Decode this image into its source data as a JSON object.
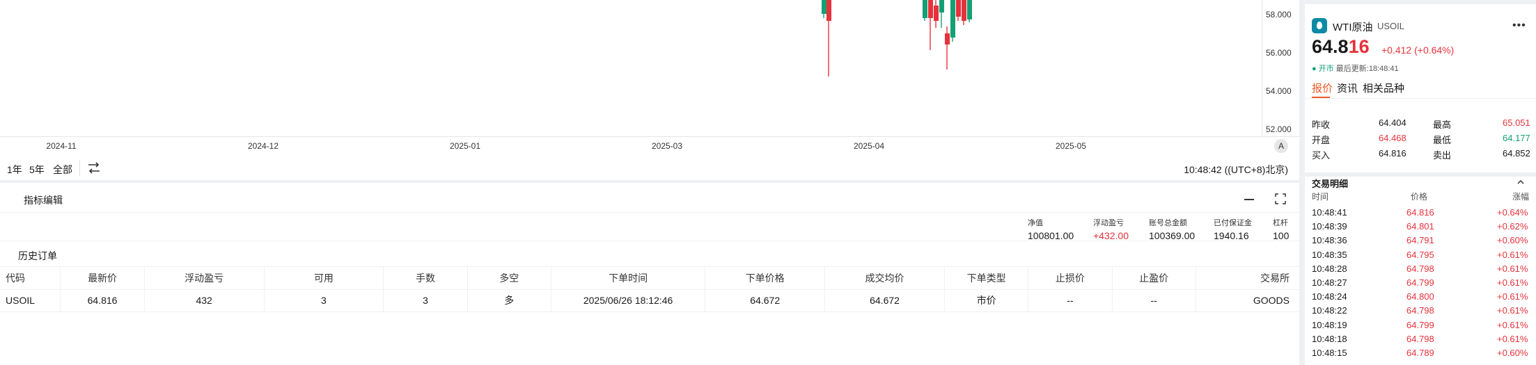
{
  "chart": {
    "price_ticks": [
      "58.000",
      "56.000",
      "54.000",
      "52.000"
    ],
    "x_ticks": [
      "2024-11",
      "2024-12",
      "2025-01",
      "2025-03",
      "2025-04",
      "2025-05"
    ],
    "auto_scale": "A",
    "colors": {
      "up": "#e5323b",
      "down": "#13a075"
    }
  },
  "range_bar": {
    "ranges": [
      "1年",
      "5年",
      "全部"
    ],
    "clock": "10:48:42 ((UTC+8)北京)"
  },
  "indicator": {
    "title": "指标编辑"
  },
  "account": [
    {
      "label": "净值",
      "value": "100801.00"
    },
    {
      "label": "浮动盈亏",
      "value": "+432.00"
    },
    {
      "label": "账号总金额",
      "value": "100369.00"
    },
    {
      "label": "已付保证金",
      "value": "1940.16"
    },
    {
      "label": "杠杆",
      "value": "100"
    }
  ],
  "history": {
    "title": "历史订单",
    "columns": [
      "代码",
      "最新价",
      "浮动盈亏",
      "可用",
      "手数",
      "多空",
      "下单时间",
      "下单价格",
      "成交均价",
      "下单类型",
      "止损价",
      "止盈价",
      "交易所"
    ],
    "rows": [
      [
        "USOIL",
        "64.816",
        "432",
        "3",
        "3",
        "多",
        "2025/06/26 18:12:46",
        "64.672",
        "64.672",
        "市价",
        "--",
        "--",
        "GOODS"
      ]
    ]
  },
  "side": {
    "name": "WTI原油",
    "code": "USOIL",
    "more": "•••",
    "price_head": "64.8",
    "price_tail": "16",
    "change": "+0.412 (+0.64%)",
    "status": "● 开市",
    "updated": "最后更新:18:48:41",
    "tabs": [
      "报价",
      "资讯",
      "相关品种"
    ],
    "quotes": [
      {
        "l1": "昨收",
        "v1": "64.404",
        "l2": "最高",
        "v2": "65.051"
      },
      {
        "l1": "开盘",
        "v1": "64.468",
        "l2": "最低",
        "v2": "64.177"
      },
      {
        "l1": "买入",
        "v1": "64.816",
        "l2": "卖出",
        "v2": "64.852"
      }
    ],
    "detail_title": "交易明细",
    "detail_columns": [
      "时间",
      "价格",
      "涨幅"
    ],
    "trades": [
      [
        "10:48:41",
        "64.816",
        "+0.64%"
      ],
      [
        "10:48:39",
        "64.801",
        "+0.62%"
      ],
      [
        "10:48:36",
        "64.791",
        "+0.60%"
      ],
      [
        "10:48:35",
        "64.795",
        "+0.61%"
      ],
      [
        "10:48:28",
        "64.798",
        "+0.61%"
      ],
      [
        "10:48:27",
        "64.799",
        "+0.61%"
      ],
      [
        "10:48:24",
        "64.800",
        "+0.61%"
      ],
      [
        "10:48:22",
        "64.798",
        "+0.61%"
      ],
      [
        "10:48:19",
        "64.799",
        "+0.61%"
      ],
      [
        "10:48:18",
        "64.798",
        "+0.61%"
      ],
      [
        "10:48:15",
        "64.789",
        "+0.60%"
      ]
    ]
  }
}
